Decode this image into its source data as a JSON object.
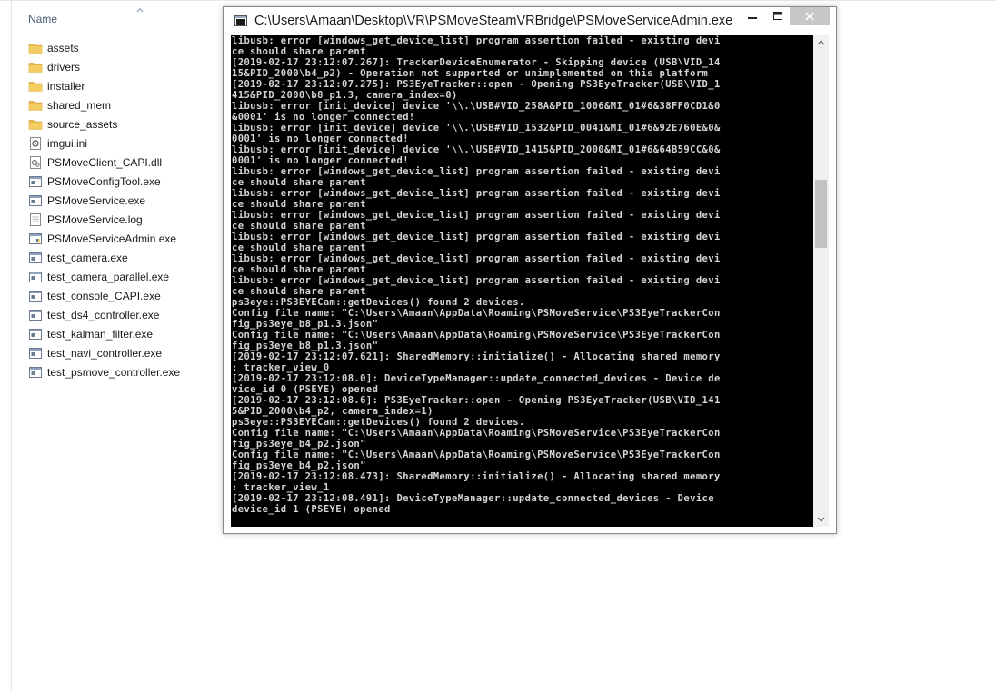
{
  "explorer": {
    "column_name": "Name",
    "files": [
      {
        "name": "assets",
        "icon": "folder-icon"
      },
      {
        "name": "drivers",
        "icon": "folder-icon"
      },
      {
        "name": "installer",
        "icon": "folder-icon"
      },
      {
        "name": "shared_mem",
        "icon": "folder-icon"
      },
      {
        "name": "source_assets",
        "icon": "folder-icon"
      },
      {
        "name": "imgui.ini",
        "icon": "settings-file-icon"
      },
      {
        "name": "PSMoveClient_CAPI.dll",
        "icon": "dll-file-icon"
      },
      {
        "name": "PSMoveConfigTool.exe",
        "icon": "exe-file-icon"
      },
      {
        "name": "PSMoveService.exe",
        "icon": "exe-file-icon"
      },
      {
        "name": "PSMoveService.log",
        "icon": "text-file-icon"
      },
      {
        "name": "PSMoveServiceAdmin.exe",
        "icon": "exe-admin-file-icon"
      },
      {
        "name": "test_camera.exe",
        "icon": "exe-file-icon"
      },
      {
        "name": "test_camera_parallel.exe",
        "icon": "exe-file-icon"
      },
      {
        "name": "test_console_CAPI.exe",
        "icon": "exe-file-icon"
      },
      {
        "name": "test_ds4_controller.exe",
        "icon": "exe-file-icon"
      },
      {
        "name": "test_kalman_filter.exe",
        "icon": "exe-file-icon"
      },
      {
        "name": "test_navi_controller.exe",
        "icon": "exe-file-icon"
      },
      {
        "name": "test_psmove_controller.exe",
        "icon": "exe-file-icon"
      }
    ]
  },
  "console_window": {
    "title": "C:\\Users\\Amaan\\Desktop\\VR\\PSMoveSteamVRBridge\\PSMoveServiceAdmin.exe",
    "minimize_icon": "minimize-icon",
    "maximize_icon": "maximize-icon",
    "close_icon": "close-icon",
    "output": "libusb: error [windows_get_device_list] program assertion failed - existing devi\nce should share parent\n[2019-02-17 23:12:07.267]: TrackerDeviceEnumerator - Skipping device (USB\\VID_14\n15&PID_2000\\b4_p2) - Operation not supported or unimplemented on this platform\n[2019-02-17 23:12:07.275]: PS3EyeTracker::open - Opening PS3EyeTracker(USB\\VID_1\n415&PID_2000\\b8_p1.3, camera_index=0)\nlibusb: error [init_device] device '\\\\.\\USB#VID_258A&PID_1006&MI_01#6&38FF0CD1&0\n&0001' is no longer connected!\nlibusb: error [init_device] device '\\\\.\\USB#VID_1532&PID_0041&MI_01#6&92E760E&0&\n0001' is no longer connected!\nlibusb: error [init_device] device '\\\\.\\USB#VID_1415&PID_2000&MI_01#6&64B59CC&0&\n0001' is no longer connected!\nlibusb: error [windows_get_device_list] program assertion failed - existing devi\nce should share parent\nlibusb: error [windows_get_device_list] program assertion failed - existing devi\nce should share parent\nlibusb: error [windows_get_device_list] program assertion failed - existing devi\nce should share parent\nlibusb: error [windows_get_device_list] program assertion failed - existing devi\nce should share parent\nlibusb: error [windows_get_device_list] program assertion failed - existing devi\nce should share parent\nlibusb: error [windows_get_device_list] program assertion failed - existing devi\nce should share parent\nps3eye::PS3EYECam::getDevices() found 2 devices.\nConfig file name: \"C:\\Users\\Amaan\\AppData\\Roaming\\PSMoveService\\PS3EyeTrackerCon\nfig_ps3eye_b8_p1.3.json\"\nConfig file name: \"C:\\Users\\Amaan\\AppData\\Roaming\\PSMoveService\\PS3EyeTrackerCon\nfig_ps3eye_b8_p1.3.json\"\n[2019-02-17 23:12:07.621]: SharedMemory::initialize() - Allocating shared memory\n: tracker_view_0\n[2019-02-17 23:12:08.0]: DeviceTypeManager::update_connected_devices - Device de\nvice_id 0 (PSEYE) opened\n[2019-02-17 23:12:08.6]: PS3EyeTracker::open - Opening PS3EyeTracker(USB\\VID_141\n5&PID_2000\\b4_p2, camera_index=1)\nps3eye::PS3EYECam::getDevices() found 2 devices.\nConfig file name: \"C:\\Users\\Amaan\\AppData\\Roaming\\PSMoveService\\PS3EyeTrackerCon\nfig_ps3eye_b4_p2.json\"\nConfig file name: \"C:\\Users\\Amaan\\AppData\\Roaming\\PSMoveService\\PS3EyeTrackerCon\nfig_ps3eye_b4_p2.json\"\n[2019-02-17 23:12:08.473]: SharedMemory::initialize() - Allocating shared memory\n: tracker_view_1\n[2019-02-17 23:12:08.491]: DeviceTypeManager::update_connected_devices - Device\ndevice_id 1 (PSEYE) opened"
  },
  "colors": {
    "folder": "#e8b94a",
    "console_bg": "#000000",
    "console_text": "#d4d4d4",
    "close_button": "#c7c7c7",
    "header_text": "#4c607a"
  }
}
